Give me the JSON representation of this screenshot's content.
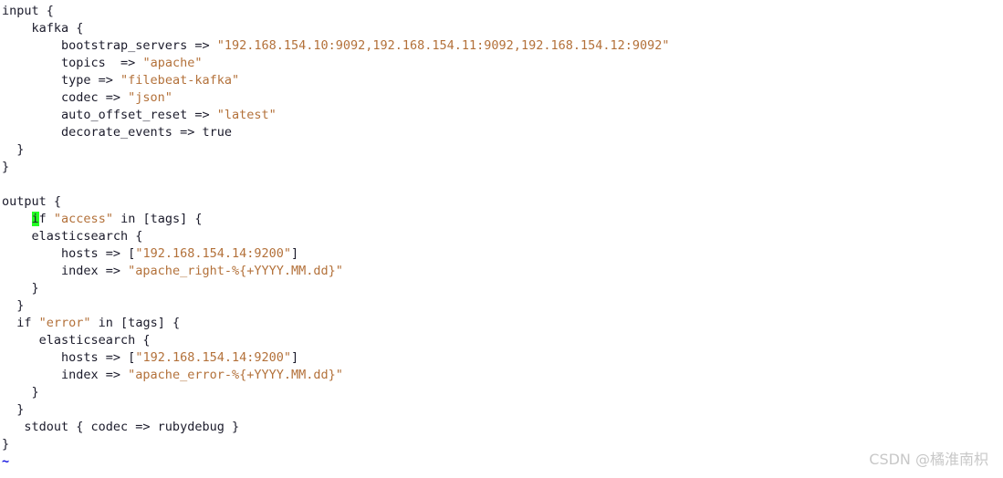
{
  "app": {
    "kind": "terminal-text-editor",
    "background_color": "#ffffff",
    "foreground_color": "#1b1b2b",
    "string_color": "#b3713a",
    "cursor_color": "#23ff23",
    "tilde_color": "#1515e0"
  },
  "watermark": {
    "text": "CSDN @橘淮南枳",
    "color": "#c8c8c8"
  },
  "editor": {
    "cursor": {
      "line": 12,
      "column": 5,
      "char": "i"
    },
    "lines": [
      {
        "index": 1,
        "text": "input {",
        "tokens": [
          {
            "t": "input {",
            "c": "plain"
          }
        ]
      },
      {
        "index": 2,
        "text": "    kafka {",
        "tokens": [
          {
            "t": "    kafka {",
            "c": "plain"
          }
        ]
      },
      {
        "index": 3,
        "text": "        bootstrap_servers => \"192.168.154.10:9092,192.168.154.11:9092,192.168.154.12:9092\"",
        "tokens": [
          {
            "t": "        bootstrap_servers => ",
            "c": "plain"
          },
          {
            "t": "\"192.168.154.10:9092,192.168.154.11:9092,192.168.154.12:9092\"",
            "c": "string"
          }
        ]
      },
      {
        "index": 4,
        "text": "        topics  => \"apache\"",
        "tokens": [
          {
            "t": "        topics  => ",
            "c": "plain"
          },
          {
            "t": "\"apache\"",
            "c": "string"
          }
        ]
      },
      {
        "index": 5,
        "text": "        type => \"filebeat-kafka\"",
        "tokens": [
          {
            "t": "        type => ",
            "c": "plain"
          },
          {
            "t": "\"filebeat-kafka\"",
            "c": "string"
          }
        ]
      },
      {
        "index": 6,
        "text": "        codec => \"json\"",
        "tokens": [
          {
            "t": "        codec => ",
            "c": "plain"
          },
          {
            "t": "\"json\"",
            "c": "string"
          }
        ]
      },
      {
        "index": 7,
        "text": "        auto_offset_reset => \"latest\"",
        "tokens": [
          {
            "t": "        auto_offset_reset => ",
            "c": "plain"
          },
          {
            "t": "\"latest\"",
            "c": "string"
          }
        ]
      },
      {
        "index": 8,
        "text": "        decorate_events => true",
        "tokens": [
          {
            "t": "        decorate_events => true",
            "c": "plain"
          }
        ]
      },
      {
        "index": 9,
        "text": "  }",
        "tokens": [
          {
            "t": "  }",
            "c": "plain"
          }
        ]
      },
      {
        "index": 10,
        "text": "}",
        "tokens": [
          {
            "t": "}",
            "c": "plain"
          }
        ]
      },
      {
        "index": 11,
        "text": "",
        "tokens": []
      },
      {
        "index": 12,
        "text": "output {",
        "tokens": [
          {
            "t": "output {",
            "c": "plain"
          }
        ]
      },
      {
        "index": 13,
        "text": "    if \"access\" in [tags] {",
        "tokens": [
          {
            "t": "    ",
            "c": "plain"
          },
          {
            "t": "i",
            "c": "cursor"
          },
          {
            "t": "f ",
            "c": "plain"
          },
          {
            "t": "\"access\"",
            "c": "string"
          },
          {
            "t": " in [tags] {",
            "c": "plain"
          }
        ]
      },
      {
        "index": 14,
        "text": "    elasticsearch {",
        "tokens": [
          {
            "t": "    elasticsearch {",
            "c": "plain"
          }
        ]
      },
      {
        "index": 15,
        "text": "        hosts => [\"192.168.154.14:9200\"]",
        "tokens": [
          {
            "t": "        hosts => [",
            "c": "plain"
          },
          {
            "t": "\"192.168.154.14:9200\"",
            "c": "string"
          },
          {
            "t": "]",
            "c": "plain"
          }
        ]
      },
      {
        "index": 16,
        "text": "        index => \"apache_right-%{+YYYY.MM.dd}\"",
        "tokens": [
          {
            "t": "        index => ",
            "c": "plain"
          },
          {
            "t": "\"apache_right-%{+YYYY.MM.dd}\"",
            "c": "string"
          }
        ]
      },
      {
        "index": 17,
        "text": "    }",
        "tokens": [
          {
            "t": "    }",
            "c": "plain"
          }
        ]
      },
      {
        "index": 18,
        "text": "  }",
        "tokens": [
          {
            "t": "  }",
            "c": "plain"
          }
        ]
      },
      {
        "index": 19,
        "text": "  if \"error\" in [tags] {",
        "tokens": [
          {
            "t": "  if ",
            "c": "plain"
          },
          {
            "t": "\"error\"",
            "c": "string"
          },
          {
            "t": " in [tags] {",
            "c": "plain"
          }
        ]
      },
      {
        "index": 20,
        "text": "     elasticsearch {",
        "tokens": [
          {
            "t": "     elasticsearch {",
            "c": "plain"
          }
        ]
      },
      {
        "index": 21,
        "text": "        hosts => [\"192.168.154.14:9200\"]",
        "tokens": [
          {
            "t": "        hosts => [",
            "c": "plain"
          },
          {
            "t": "\"192.168.154.14:9200\"",
            "c": "string"
          },
          {
            "t": "]",
            "c": "plain"
          }
        ]
      },
      {
        "index": 22,
        "text": "        index => \"apache_error-%{+YYYY.MM.dd}\"",
        "tokens": [
          {
            "t": "        index => ",
            "c": "plain"
          },
          {
            "t": "\"apache_error-%{+YYYY.MM.dd}\"",
            "c": "string"
          }
        ]
      },
      {
        "index": 23,
        "text": "    }",
        "tokens": [
          {
            "t": "    }",
            "c": "plain"
          }
        ]
      },
      {
        "index": 24,
        "text": "  }",
        "tokens": [
          {
            "t": "  }",
            "c": "plain"
          }
        ]
      },
      {
        "index": 25,
        "text": "   stdout { codec => rubydebug }",
        "tokens": [
          {
            "t": "   stdout { codec => rubydebug }",
            "c": "plain"
          }
        ]
      },
      {
        "index": 26,
        "text": "}",
        "tokens": [
          {
            "t": "}",
            "c": "plain"
          }
        ]
      },
      {
        "index": 27,
        "text": "~",
        "tokens": [
          {
            "t": "~",
            "c": "tilde"
          }
        ]
      }
    ]
  }
}
